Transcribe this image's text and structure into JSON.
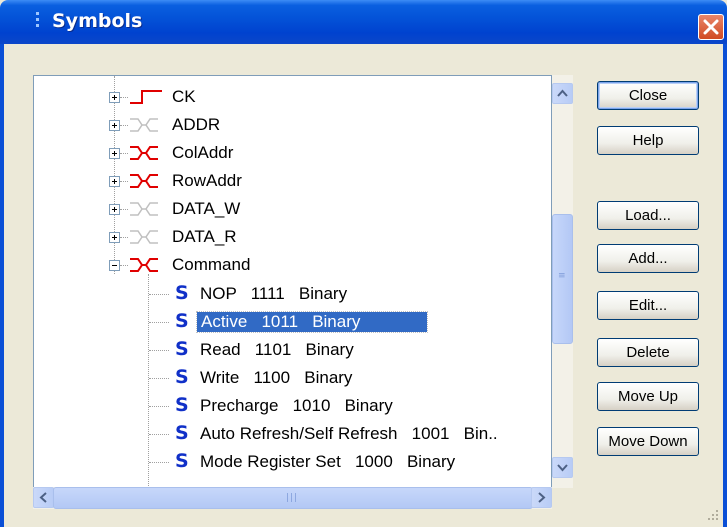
{
  "window": {
    "title": "Symbols"
  },
  "tree": {
    "groups": [
      {
        "label": "CK",
        "signal": "clock",
        "color": "#E00000"
      },
      {
        "label": "ADDR",
        "signal": "bus",
        "color": "#C0C0C0"
      },
      {
        "label": "ColAddr",
        "signal": "bus",
        "color": "#E00000"
      },
      {
        "label": "RowAddr",
        "signal": "bus",
        "color": "#E00000"
      },
      {
        "label": "DATA_W",
        "signal": "bus",
        "color": "#C0C0C0"
      },
      {
        "label": "DATA_R",
        "signal": "bus",
        "color": "#C0C0C0"
      },
      {
        "label": "Command",
        "signal": "bus",
        "color": "#E00000",
        "expanded": true
      }
    ],
    "symbols": [
      {
        "text": "NOP   1111   Binary"
      },
      {
        "text": "Active   1011   Binary",
        "selected": true
      },
      {
        "text": "Read   1101   Binary"
      },
      {
        "text": "Write   1100   Binary"
      },
      {
        "text": "Precharge   1010   Binary"
      },
      {
        "text": "Auto Refresh/Self Refresh   1001   Bin.."
      },
      {
        "text": "Mode Register Set   1000   Binary"
      }
    ],
    "symbol_icon": "S"
  },
  "buttons": {
    "close": "Close",
    "help": "Help",
    "load": "Load...",
    "add": "Add...",
    "edit": "Edit...",
    "delete": "Delete",
    "move_up": "Move Up",
    "move_down": "Move Down"
  },
  "icons": {
    "window_grip": "title-grip-icon",
    "close": "close-x-icon",
    "expander_plus": "plus-box-icon",
    "expander_minus": "minus-box-icon",
    "clock_signal": "clock-signal-icon",
    "bus_signal": "bus-signal-icon",
    "symbol": "symbol-s-icon",
    "scroll_up": "arrow-up-icon",
    "scroll_down": "arrow-down-icon",
    "scroll_left": "arrow-left-icon",
    "scroll_right": "arrow-right-icon"
  },
  "colors": {
    "selection": "#316AC5",
    "symbol_icon": "#1030C8",
    "signal_active": "#E00000",
    "signal_inactive": "#C0C0C0"
  }
}
